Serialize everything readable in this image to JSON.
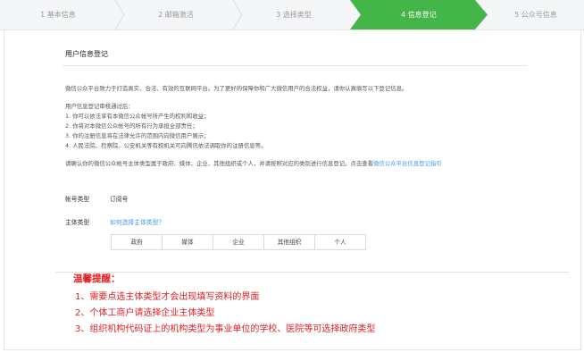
{
  "steps": [
    {
      "label": "1 基本信息",
      "active": false
    },
    {
      "label": "2 邮箱激活",
      "active": false
    },
    {
      "label": "3 选择类型",
      "active": false
    },
    {
      "label": "4 信息登记",
      "active": true
    },
    {
      "label": "5 公众号信息",
      "active": false
    }
  ],
  "page": {
    "title": "用户信息登记",
    "intro": "微信公众平台致力于打造真实、合法、有效的互联网平台。为了更好的保障你和广大微信用户的合法权益，请你认真填写以下登记信息。",
    "after_title": "用户信息登记审核通过后：",
    "after_items": [
      "1. 你可以依法享有本微信公众帐号所产生的权利和收益；",
      "2. 你将对本微信公众帐号的所有行为承担全部责任；",
      "3. 你的注册信息将在法律允许的范围内向微信用户展示；",
      "4. 人民法院、检察院、公安机关等有权机关可向腾讯依法调取你的注册信息等。"
    ],
    "confirm_text": "请确认你的微信公众帐号主体类型属于政府、媒体、企业、其他组织或个人，并请按照对应的类别进行信息登记。点击查看",
    "confirm_link": "微信公众平台信息登记指引"
  },
  "form": {
    "account_type_label": "帐号类型",
    "account_type_value": "订阅号",
    "subject_type_label": "主体类型",
    "subject_help_link": "如何选择主体类型？",
    "types": [
      "政府",
      "媒体",
      "企业",
      "其他组织",
      "个人"
    ]
  },
  "notice": {
    "title": "温馨提醒：",
    "lines": [
      "1、需要点选主体类型才会出现填写资料的界面",
      "2、个体工商户请选择企业主体类型",
      "3、组织机构代码证上的机构类型为事业单位的学校、医院等可选择政府类型"
    ]
  },
  "colors": {
    "accent": "#44b549",
    "link": "#459ae9",
    "warning": "#e02020"
  }
}
